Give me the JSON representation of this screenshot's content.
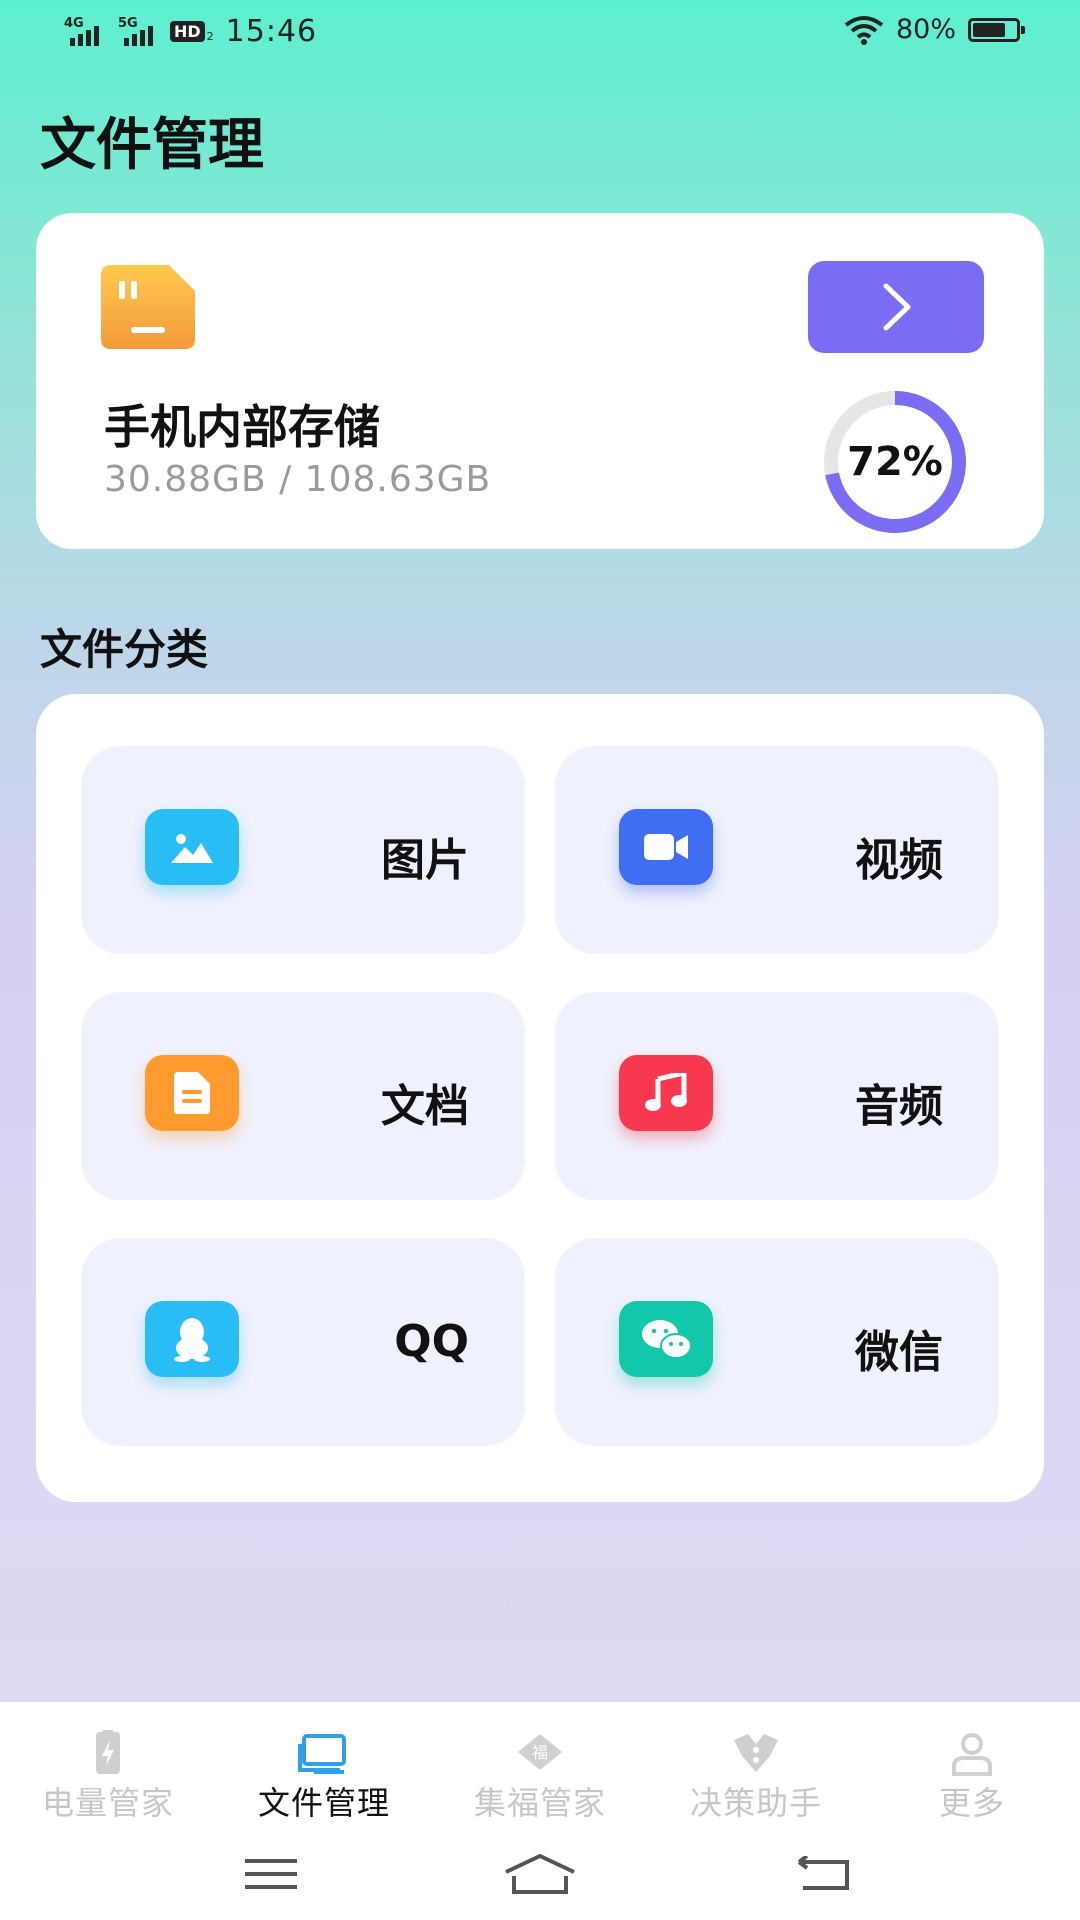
{
  "status_bar": {
    "network1": "4G",
    "network2": "5G",
    "hd": "HD",
    "hd_sub": "2",
    "time": "15:46",
    "battery_percent": "80%",
    "battery_level": 0.8,
    "icons": [
      "signal-icon",
      "wifi-icon",
      "battery-icon"
    ]
  },
  "page": {
    "title": "文件管理"
  },
  "storage": {
    "name": "手机内部存储",
    "size_text": "30.88GB  /  108.63GB",
    "usage_label": "72%",
    "usage_fraction": 0.72,
    "icon": "sd-card-icon",
    "arrow_icon": "chevron-right-icon",
    "accent_color": "#7b6cf4",
    "ring_track_color": "#e6e6e6"
  },
  "categories": {
    "title": "文件分类",
    "items": [
      {
        "label": "图片",
        "icon": "image-icon",
        "color": "#29bdf5"
      },
      {
        "label": "视频",
        "icon": "video-icon",
        "color": "#3f6ef5"
      },
      {
        "label": "文档",
        "icon": "document-icon",
        "color": "#ff9a2e"
      },
      {
        "label": "音频",
        "icon": "music-icon",
        "color": "#f7384f"
      },
      {
        "label": "QQ",
        "icon": "qq-penguin-icon",
        "color": "#29bdf5"
      },
      {
        "label": "微信",
        "icon": "wechat-icon",
        "color": "#12c8a8"
      }
    ]
  },
  "tabs": [
    {
      "label": "电量管家",
      "icon": "battery-manager-icon",
      "active": false
    },
    {
      "label": "文件管理",
      "icon": "folder-icon",
      "active": true,
      "color": "#2ea0e8"
    },
    {
      "label": "集福管家",
      "icon": "fortune-icon",
      "active": false
    },
    {
      "label": "决策助手",
      "icon": "decision-icon",
      "active": false
    },
    {
      "label": "更多",
      "icon": "person-icon",
      "active": false
    }
  ],
  "system_nav": [
    "menu-icon",
    "home-icon",
    "back-icon"
  ]
}
